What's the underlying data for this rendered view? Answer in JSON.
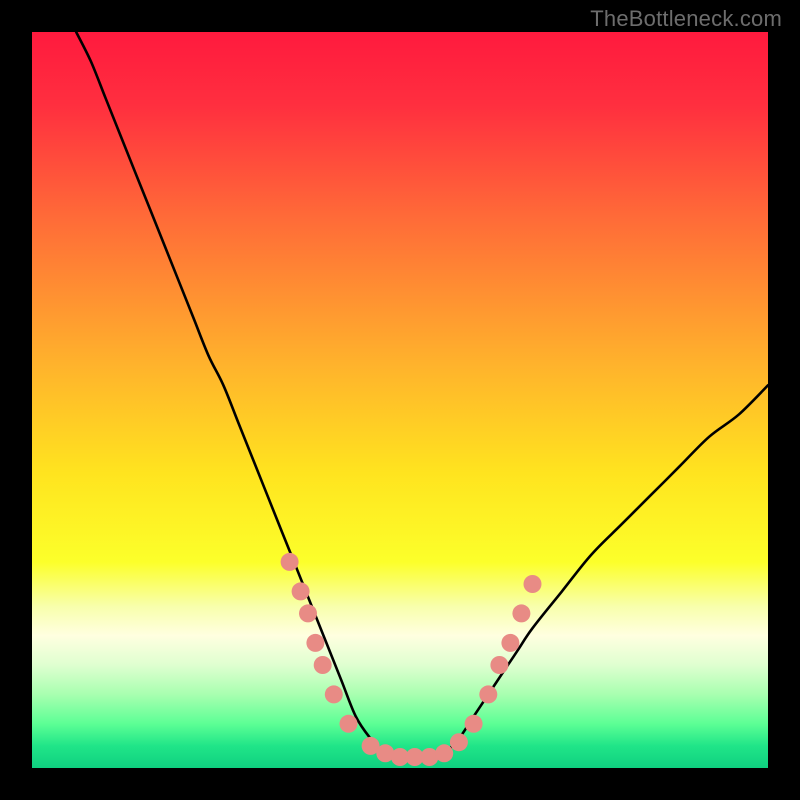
{
  "watermark": "TheBottleneck.com",
  "chart_data": {
    "type": "line",
    "title": "",
    "xlabel": "",
    "ylabel": "",
    "xlim": [
      0,
      100
    ],
    "ylim": [
      0,
      100
    ],
    "gradient_stops": [
      {
        "pos": 0.0,
        "color": "#ff1a3e"
      },
      {
        "pos": 0.1,
        "color": "#ff2f3f"
      },
      {
        "pos": 0.25,
        "color": "#ff6a38"
      },
      {
        "pos": 0.45,
        "color": "#ffb22c"
      },
      {
        "pos": 0.6,
        "color": "#ffe41f"
      },
      {
        "pos": 0.72,
        "color": "#fcff2a"
      },
      {
        "pos": 0.78,
        "color": "#f8ffab"
      },
      {
        "pos": 0.82,
        "color": "#ffffe0"
      },
      {
        "pos": 0.86,
        "color": "#dfffd0"
      },
      {
        "pos": 0.9,
        "color": "#a8ffb0"
      },
      {
        "pos": 0.94,
        "color": "#5cff95"
      },
      {
        "pos": 0.97,
        "color": "#20e588"
      },
      {
        "pos": 1.0,
        "color": "#0fd080"
      }
    ],
    "series": [
      {
        "name": "bottleneck-curve",
        "x": [
          6,
          8,
          10,
          12,
          14,
          16,
          18,
          20,
          22,
          24,
          26,
          28,
          30,
          32,
          34,
          36,
          38,
          40,
          42,
          44,
          46,
          48,
          50,
          52,
          54,
          56,
          58,
          60,
          62,
          64,
          66,
          68,
          72,
          76,
          80,
          84,
          88,
          92,
          96,
          100
        ],
        "y": [
          100,
          96,
          91,
          86,
          81,
          76,
          71,
          66,
          61,
          56,
          52,
          47,
          42,
          37,
          32,
          27,
          22,
          17,
          12,
          7,
          4,
          2,
          1,
          1,
          1,
          2,
          4,
          7,
          10,
          13,
          16,
          19,
          24,
          29,
          33,
          37,
          41,
          45,
          48,
          52
        ]
      }
    ],
    "markers": {
      "name": "marker-dots",
      "color": "#e88b85",
      "radius_px": 9,
      "points_xy": [
        [
          35,
          28
        ],
        [
          36.5,
          24
        ],
        [
          37.5,
          21
        ],
        [
          38.5,
          17
        ],
        [
          39.5,
          14
        ],
        [
          41,
          10
        ],
        [
          43,
          6
        ],
        [
          46,
          3
        ],
        [
          48,
          2
        ],
        [
          50,
          1.5
        ],
        [
          52,
          1.5
        ],
        [
          54,
          1.5
        ],
        [
          56,
          2
        ],
        [
          58,
          3.5
        ],
        [
          60,
          6
        ],
        [
          62,
          10
        ],
        [
          63.5,
          14
        ],
        [
          65,
          17
        ],
        [
          66.5,
          21
        ],
        [
          68,
          25
        ]
      ]
    }
  }
}
